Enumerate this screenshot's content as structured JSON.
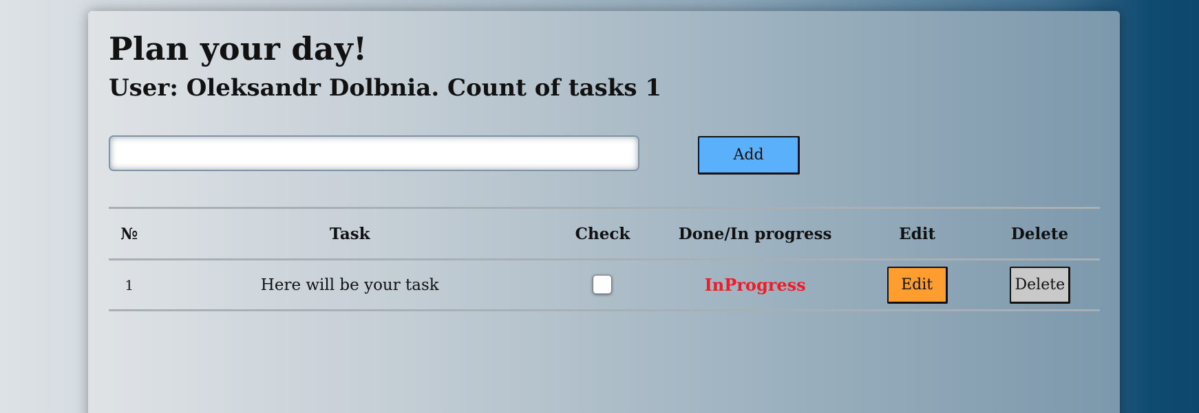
{
  "header": {
    "title": "Plan your day!",
    "subtitle": "User: Oleksandr Dolbnia. Count of tasks 1"
  },
  "new_task": {
    "value": "",
    "placeholder": "",
    "add_label": "Add"
  },
  "table": {
    "columns": [
      "№",
      "Task",
      "Check",
      "Done/In progress",
      "Edit",
      "Delete"
    ],
    "rows": [
      {
        "num": "1",
        "task": "Here will be your task",
        "checked": false,
        "status": "InProgress",
        "edit_label": "Edit",
        "delete_label": "Delete"
      }
    ]
  },
  "colors": {
    "add_button": "#5ab0fb",
    "edit_button": "#ff9e2e",
    "delete_button": "#c9c9c9",
    "status_in_progress": "#ee1c24"
  }
}
